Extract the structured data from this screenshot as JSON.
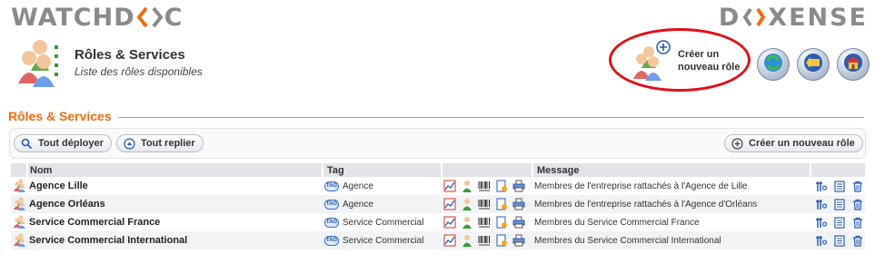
{
  "brand": {
    "left": [
      "WATCHD",
      "C"
    ],
    "right": [
      "D",
      "XENSE"
    ]
  },
  "header": {
    "title": "Rôles & Services",
    "subtitle": "Liste des rôles disponibles"
  },
  "top_actions": {
    "create_role_line1": "Créer un",
    "create_role_line2": "nouveau rôle"
  },
  "section": {
    "title": "Rôles & Services"
  },
  "toolbar": {
    "expand_all": "Tout déployer",
    "collapse_all": "Tout replier",
    "create_role": "Créer un nouveau rôle"
  },
  "table": {
    "columns": [
      "Nom",
      "Tag",
      "Message"
    ],
    "rows": [
      {
        "name": "Agence Lille",
        "tag": "Agence",
        "message": "Membres de l'entreprise rattachés à l'Agence de Lille"
      },
      {
        "name": "Agence Orléans",
        "tag": "Agence",
        "message": "Membres de l'entreprise rattachés à l'Agence d'Orléans"
      },
      {
        "name": "Service Commercial France",
        "tag": "Service Commercial",
        "message": "Membres du Service Commercial France"
      },
      {
        "name": "Service Commercial International",
        "tag": "Service Commercial",
        "message": "Membres du Service Commercial International"
      }
    ]
  },
  "icons": {
    "header": "roles-people-icon",
    "refresh": "refresh-icon",
    "back": "back-arrow-icon",
    "home": "home-icon",
    "row_actions": [
      "report-icon",
      "user-icon",
      "barcode-icon",
      "document-icon",
      "printer-icon"
    ],
    "row_ops": [
      "edit-tools-icon",
      "duplicate-icon",
      "delete-icon"
    ]
  },
  "colors": {
    "accent": "#f06d13",
    "highlight_ring": "#e0101a",
    "header_bg": "#e2e4e8"
  }
}
